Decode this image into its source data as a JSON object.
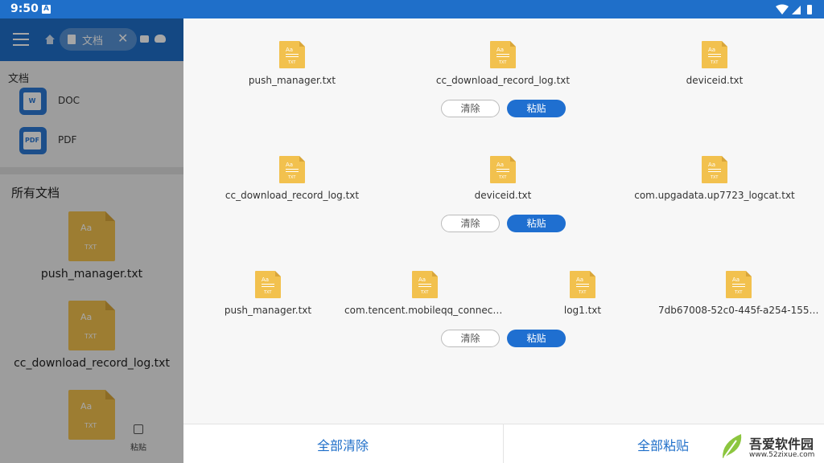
{
  "status_bar": {
    "time": "9:50",
    "notif_icon": "A"
  },
  "left_app": {
    "tab_label": "文档",
    "tab_close": "✕",
    "section_title": "文档",
    "types": [
      {
        "badge": "W",
        "label": "DOC"
      },
      {
        "badge": "PDF",
        "label": "PDF"
      }
    ],
    "all_docs_title": "所有文档",
    "files": [
      {
        "name": "push_manager.txt"
      },
      {
        "name": "cc_download_record_log.txt"
      },
      {
        "name": ""
      }
    ],
    "icon_aa": "Aa",
    "icon_txt": "TXT",
    "paste_label": "粘贴"
  },
  "clipboard": {
    "icon_aa": "Aa",
    "icon_txt": "TXT",
    "groups": [
      {
        "files": [
          "push_manager.txt",
          "cc_download_record_log.txt",
          "deviceid.txt"
        ],
        "clear_label": "清除",
        "paste_label": "粘贴"
      },
      {
        "files": [
          "cc_download_record_log.txt",
          "deviceid.txt",
          "com.upgadata.up7723_logcat.txt"
        ],
        "clear_label": "清除",
        "paste_label": "粘贴"
      },
      {
        "files": [
          "push_manager.txt",
          "com.tencent.mobileqq_connectS...",
          "log1.txt",
          "7db67008-52c0-445f-a254-15513..."
        ],
        "clear_label": "清除",
        "paste_label": "粘贴"
      }
    ],
    "clear_all_label": "全部清除",
    "paste_all_label": "全部粘贴"
  },
  "watermark": {
    "title": "吾爱软件园",
    "url": "www.52zixue.com"
  },
  "colors": {
    "accent": "#1f6fc9",
    "file_icon": "#f2c14e",
    "paste_button": "#1f6fd0"
  }
}
